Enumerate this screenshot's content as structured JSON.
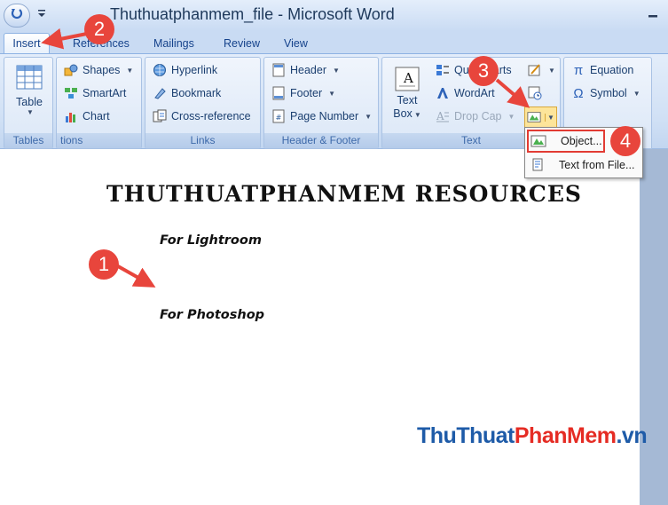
{
  "window": {
    "title": "Thuthuatphanmem_file - Microsoft Word"
  },
  "tabs": [
    {
      "label": "Insert",
      "active": true
    },
    {
      "label": "References"
    },
    {
      "label": "Mailings"
    },
    {
      "label": "Review"
    },
    {
      "label": "View"
    }
  ],
  "ribbon": {
    "tables": {
      "label": "Tables",
      "table": "Table"
    },
    "illustrations": {
      "label": "tions",
      "shapes": "Shapes",
      "smartart": "SmartArt",
      "chart": "Chart"
    },
    "links": {
      "label": "Links",
      "hyperlink": "Hyperlink",
      "bookmark": "Bookmark",
      "crossref": "Cross-reference"
    },
    "header_footer": {
      "label": "Header & Footer",
      "header": "Header",
      "footer": "Footer",
      "page_number": "Page Number"
    },
    "text": {
      "label": "Text",
      "textbox_line1": "Text",
      "textbox_line2": "Box",
      "quickparts": "Quick Parts",
      "wordart": "WordArt",
      "dropcap": "Drop Cap"
    },
    "symbols": {
      "equation": "Equation",
      "symbol": "Symbol"
    }
  },
  "object_menu": {
    "items": [
      {
        "label": "Object..."
      },
      {
        "label": "Text from File..."
      }
    ]
  },
  "document": {
    "heading": "THUTHUATPHANMEM RESOURCES",
    "line1": "For Lightroom",
    "line2": "For Photoshop"
  },
  "steps": [
    "1",
    "2",
    "3",
    "4"
  ],
  "watermark": {
    "part1": "Thu",
    "part2": "Thuat",
    "part3": "PhanMem",
    "part4": ".vn"
  },
  "colors": {
    "annotation": "#e8453c",
    "ribbon": "#d0e0f5",
    "tab_text": "#15428b"
  }
}
